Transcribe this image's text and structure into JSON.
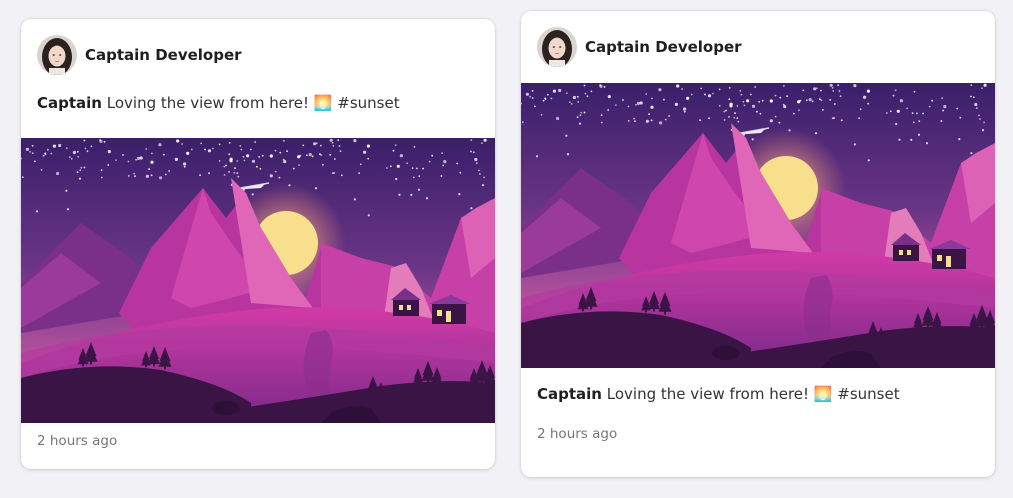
{
  "posts": [
    {
      "author": "Captain Developer",
      "caption_user": "Captain",
      "caption_text": " Loving the view from here! 🌅 #sunset",
      "timestamp": "2 hours ago",
      "layout": "caption-above-image"
    },
    {
      "author": "Captain Developer",
      "caption_user": "Captain",
      "caption_text": " Loving the view from here! 🌅 #sunset",
      "timestamp": "2 hours ago",
      "layout": "caption-below-image"
    }
  ],
  "colors": {
    "page_bg": "#f2f2f6",
    "card_bg": "#ffffff",
    "sky_top": "#3a1f6b",
    "sky_bottom": "#b24aa8",
    "sun": "#f7df8e",
    "mountain": "#c23ba8",
    "hills": "#3b1446"
  },
  "icons": {
    "avatar": "user-avatar-photo",
    "image": "sunset-landscape-illustration"
  }
}
